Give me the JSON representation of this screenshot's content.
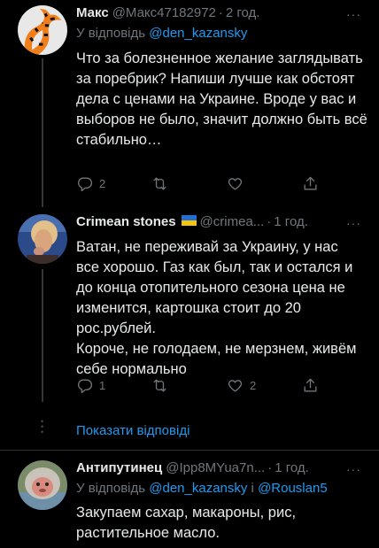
{
  "tweets": [
    {
      "name": "Макс",
      "handle": "@Макс47182972",
      "time": "2 год.",
      "reply_prefix": "У відповідь ",
      "reply_mentions": "@den_kazansky",
      "text_lines": [
        "Что за болезненное желание заглядывать за поребрик? Напиши лучше как обстоят дела с ценами на Украине. Вроде у вас и выборов не было, значит должно быть всё стабильно…"
      ],
      "replies": "2",
      "retweets": "",
      "likes": ""
    },
    {
      "name": "Crimean stones",
      "handle": "@crimea...",
      "time": "1 год.",
      "text_lines": [
        "Ватан, не переживай за Украину, у нас все хорошо. Газ как был, так и остался и до конца отопительного сезона цена не изменится, картошка стоит до 20 рос.рублей.",
        "Короче, не голодаем, не мерзнем, живём себе нормально"
      ],
      "replies": "1",
      "retweets": "",
      "likes": "2"
    },
    {
      "name": "Антипутинец",
      "handle": "@Ipp8MYua7n...",
      "time": "1 год.",
      "reply_prefix": "У відповідь ",
      "reply_mention1": "@den_kazansky",
      "reply_joiner": " і ",
      "reply_mention2": "@Rouslan5",
      "text_lines": [
        "Закупаем сахар, макароны, рис, растительное масло."
      ]
    }
  ],
  "show_replies_label": "Показати відповіді",
  "more_glyph": "···",
  "separator": "·",
  "colors": {
    "link": "#1d9bf0",
    "muted": "#71767b",
    "flag_blue": "#1f6fd6",
    "flag_yellow": "#f4c40f"
  }
}
